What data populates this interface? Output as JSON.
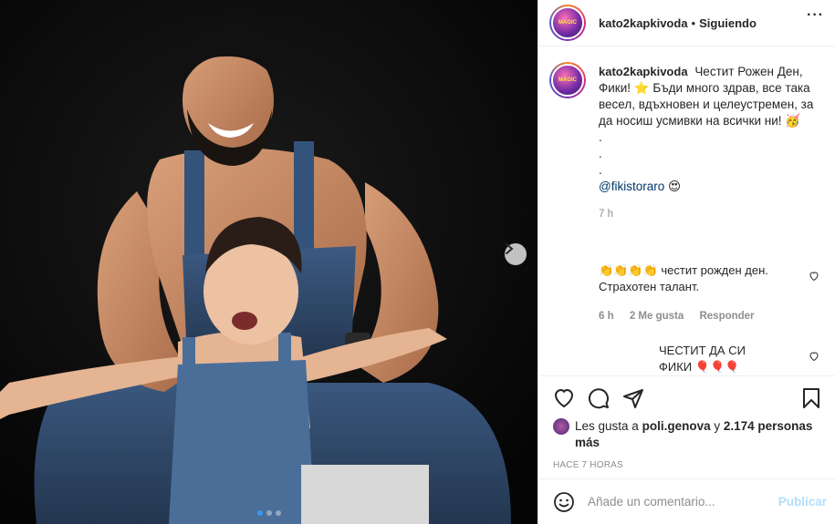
{
  "post": {
    "username": "kato2kapkivoda",
    "separator": "•",
    "following_label": "Siguiendo",
    "more_icon": "···"
  },
  "avatar": {
    "badge_text": "MAGIC"
  },
  "caption": {
    "username": "kato2kapkivoda",
    "text_part1": "Честит Рожен Ден, Фики!",
    "star_emoji": "⭐",
    "text_part2": "Бъди много здрав, все така весел, вдъхновен и целеустремен, за да носиш усмивки на всички ни!",
    "face_emoji": "🥳",
    "dot1": ".",
    "dot2": ".",
    "dot3": ".",
    "mention": "@fikistoraro",
    "heart_eyes_emoji": "😍",
    "time": "7 h"
  },
  "comments": [
    {
      "clap_emojis": "👏👏👏👏",
      "text": "честит рожден ден. Страхотен талант.",
      "time": "6 h",
      "likes": "2 Me gusta",
      "reply_label": "Responder"
    },
    {
      "text_line1": "ЧЕСТИТ ДА СИ",
      "text_line2": "ФИКИ",
      "emojis": "🎈🎈🎈"
    }
  ],
  "likes": {
    "prefix": "Les gusta a",
    "user": "poli.genova",
    "joiner": "y",
    "count": "2.174 personas más"
  },
  "post_time": "HACE 7 HORAS",
  "add_comment": {
    "placeholder": "Añade un comentario...",
    "publish_label": "Publicar"
  },
  "colors": {
    "publish_disabled": "#b2dffc",
    "mention": "#00376b",
    "active_dot": "#3897f0"
  }
}
